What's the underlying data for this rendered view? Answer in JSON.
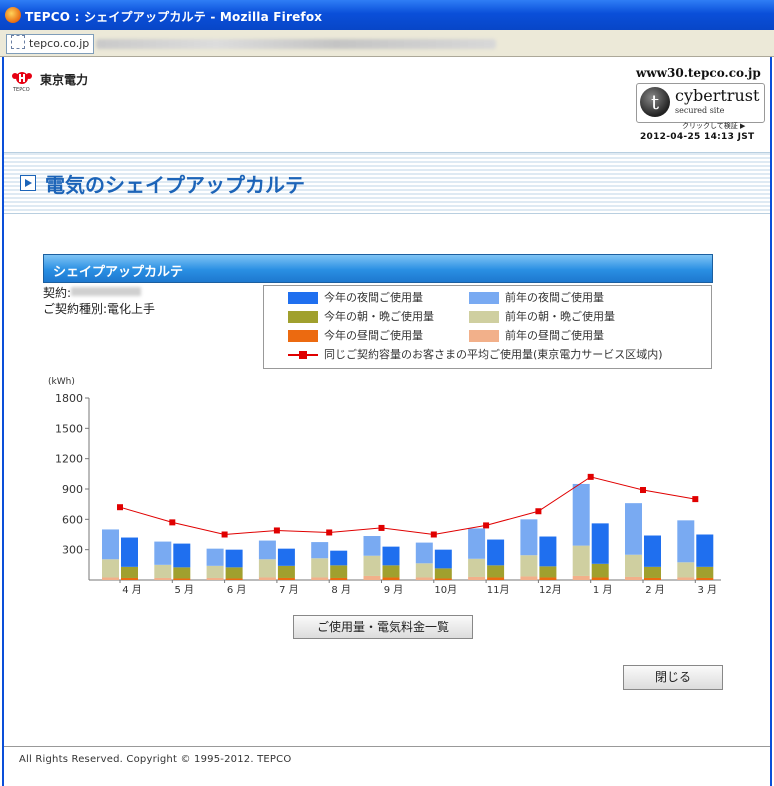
{
  "window": {
    "title": "TEPCO : シェイプアップカルテ - Mozilla Firefox",
    "url_domain": "tepco.co.jp"
  },
  "header": {
    "brand": "東京電力",
    "brand_small": "TEPCO",
    "site_domain": "www30.tepco.co.jp",
    "cybertrust_name": "cybertrust",
    "cybertrust_sub": "secured site",
    "verify_label": "クリックして検証 ▶",
    "timestamp": "2012-04-25 14:13 JST"
  },
  "banner": {
    "title": "電気のシェイプアップカルテ"
  },
  "karte": {
    "title": "シェイプアップカルテ",
    "contract_label": "契約:",
    "contract_type_label": "ご契約種別:電化上手"
  },
  "legend": {
    "night_this": "今年の夜間ご使用量",
    "night_last": "前年の夜間ご使用量",
    "morning_this": "今年の朝・晩ご使用量",
    "morning_last": "前年の朝・晩ご使用量",
    "day_this": "今年の昼間ご使用量",
    "day_last": "前年の昼間ご使用量",
    "average": "同じご契約容量のお客さまの平均ご使用量(東京電力サービス区域内)"
  },
  "colors": {
    "night_this": "#1f6fef",
    "night_last": "#79aaf2",
    "morning_this": "#a0a02e",
    "morning_last": "#cfcfa0",
    "day_this": "#ec6a10",
    "day_last": "#f2b08a",
    "average": "#e00000"
  },
  "chart_data": {
    "type": "bar",
    "ylabel": "(kWh)",
    "ylim": [
      0,
      1800
    ],
    "yticks": [
      300,
      600,
      900,
      1200,
      1500,
      1800
    ],
    "categories": [
      "4 月",
      "5 月",
      "6 月",
      "7 月",
      "8 月",
      "9 月",
      "10月",
      "11月",
      "12月",
      "1 月",
      "2 月",
      "3 月"
    ],
    "series": [
      {
        "name": "前年の昼間ご使用量",
        "values": [
          25,
          20,
          20,
          25,
          25,
          40,
          25,
          30,
          35,
          40,
          30,
          25
        ]
      },
      {
        "name": "前年の朝・晩ご使用量",
        "values": [
          180,
          130,
          120,
          180,
          190,
          200,
          140,
          180,
          210,
          300,
          220,
          150
        ]
      },
      {
        "name": "前年の夜間ご使用量",
        "values": [
          295,
          230,
          170,
          185,
          160,
          195,
          205,
          300,
          355,
          610,
          510,
          415
        ]
      },
      {
        "name": "今年の昼間ご使用量",
        "values": [
          20,
          15,
          15,
          20,
          20,
          25,
          15,
          25,
          25,
          25,
          20,
          20
        ]
      },
      {
        "name": "今年の朝・晩ご使用量",
        "values": [
          110,
          110,
          110,
          120,
          125,
          120,
          100,
          120,
          110,
          135,
          110,
          110
        ]
      },
      {
        "name": "今年の夜間ご使用量",
        "values": [
          290,
          235,
          175,
          170,
          145,
          185,
          185,
          255,
          295,
          400,
          310,
          320
        ]
      },
      {
        "name": "同じご契約容量のお客さまの平均ご使用量(東京電力サービス区域内)",
        "values": [
          720,
          570,
          450,
          490,
          470,
          515,
          450,
          540,
          680,
          1020,
          890,
          800
        ]
      }
    ]
  },
  "buttons": {
    "usage_list": "ご使用量・電気料金一覧",
    "close": "閉じる"
  },
  "footer": {
    "copyright": "All Rights Reserved. Copyright © 1995-2012. TEPCO"
  }
}
